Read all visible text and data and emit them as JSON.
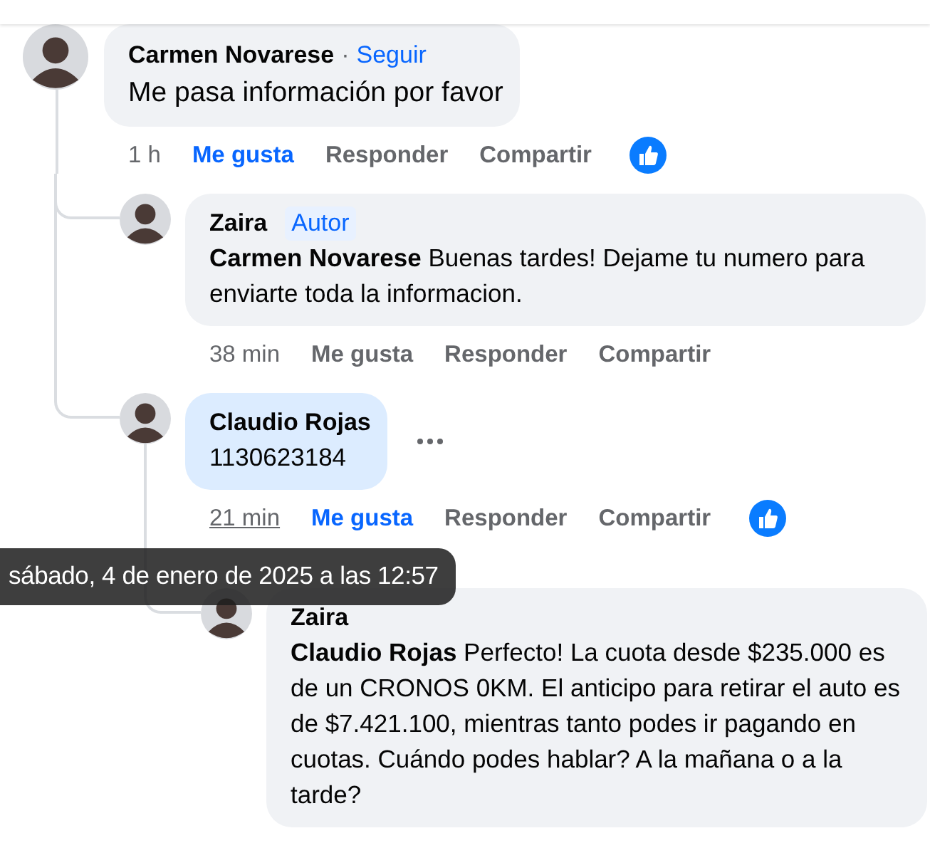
{
  "tooltip": "sábado, 4 de enero de 2025 a las 12:57",
  "comments": [
    {
      "author": "Carmen Novarese",
      "follow_separator": "·",
      "follow": "Seguir",
      "text": "Me pasa información por favor",
      "time": "1 h",
      "time_hovered": false,
      "like": "Me gusta",
      "reply": "Responder",
      "share": "Compartir",
      "liked": true,
      "reacted": true,
      "highlighted": false,
      "more_menu": false,
      "children": [
        {
          "author": "Zaira",
          "badge": "Autor",
          "text": "**Carmen Novarese** Buenas tardes! Dejame tu numero para enviarte toda la informacion.",
          "time": "38 min",
          "time_hovered": false,
          "like": "Me gusta",
          "reply": "Responder",
          "share": "Compartir",
          "liked": false,
          "reacted": false,
          "highlighted": false,
          "more_menu": false
        },
        {
          "author": "Claudio Rojas",
          "text": "1130623184",
          "time": "21 min",
          "time_hovered": true,
          "like": "Me gusta",
          "reply": "Responder",
          "share": "Compartir",
          "liked": true,
          "reacted": true,
          "highlighted": true,
          "more_menu": true,
          "children": [
            {
              "author": "Zaira",
              "text": "**Claudio Rojas** Perfecto! La cuota desde $235.000 es de un CRONOS 0KM. El anticipo para retirar el auto es de $7.421.100, mientras tanto podes ir pagando en cuotas. Cuándo podes hablar? A la mañana o a la tarde?"
            }
          ]
        }
      ]
    }
  ]
}
